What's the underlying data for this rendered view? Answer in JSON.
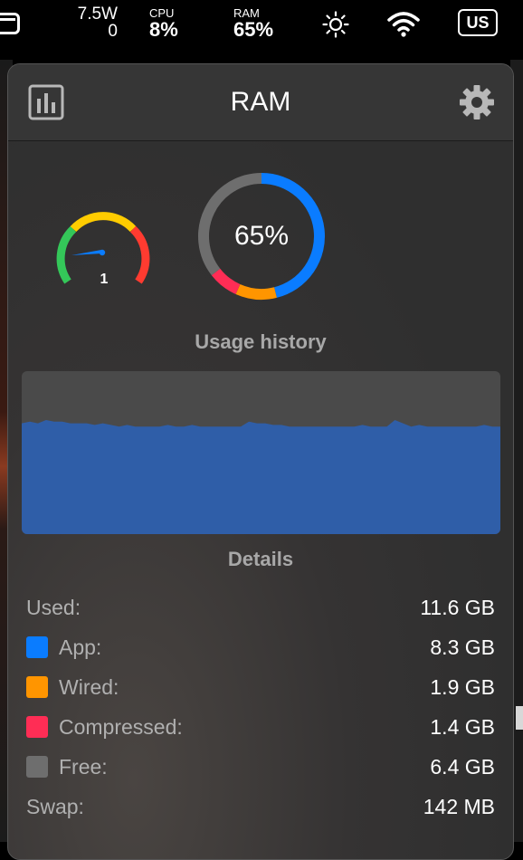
{
  "menubar": {
    "power_top": "7.5W",
    "power_bottom": "0",
    "cpu_label": "CPU",
    "cpu_value": "8%",
    "ram_label": "RAM",
    "ram_value": "65%",
    "lang": "US"
  },
  "popover": {
    "title": "RAM",
    "pressure_value": "1",
    "usage_percent": "65%",
    "usage_history_title": "Usage history",
    "details_title": "Details"
  },
  "details": [
    {
      "name": "Used:",
      "value": "11.6 GB",
      "color": null
    },
    {
      "name": "App:",
      "value": "8.3 GB",
      "color": "#0a7cff"
    },
    {
      "name": "Wired:",
      "value": "1.9 GB",
      "color": "#ff9500"
    },
    {
      "name": "Compressed:",
      "value": "1.4 GB",
      "color": "#ff2d55"
    },
    {
      "name": "Free:",
      "value": "6.4 GB",
      "color": "#6e6e6e"
    },
    {
      "name": "Swap:",
      "value": "142 MB",
      "color": null
    }
  ],
  "donut": {
    "app": 8.3,
    "wired": 1.9,
    "compressed": 1.4,
    "free": 6.4,
    "colors": {
      "app": "#0a7cff",
      "wired": "#ff9500",
      "compressed": "#ff2d55",
      "free": "#6e6e6e"
    }
  },
  "history": {
    "fill_color": "#2f5ea8",
    "values": [
      0.68,
      0.69,
      0.68,
      0.7,
      0.69,
      0.69,
      0.68,
      0.68,
      0.68,
      0.67,
      0.68,
      0.67,
      0.66,
      0.67,
      0.66,
      0.66,
      0.66,
      0.66,
      0.67,
      0.66,
      0.66,
      0.67,
      0.66,
      0.66,
      0.66,
      0.66,
      0.66,
      0.66,
      0.69,
      0.68,
      0.68,
      0.67,
      0.67,
      0.66,
      0.66,
      0.66,
      0.66,
      0.66,
      0.66,
      0.66,
      0.66,
      0.66,
      0.67,
      0.66,
      0.66,
      0.66,
      0.7,
      0.68,
      0.66,
      0.67,
      0.66,
      0.66,
      0.66,
      0.66,
      0.66,
      0.66,
      0.66,
      0.67,
      0.66,
      0.66
    ]
  }
}
